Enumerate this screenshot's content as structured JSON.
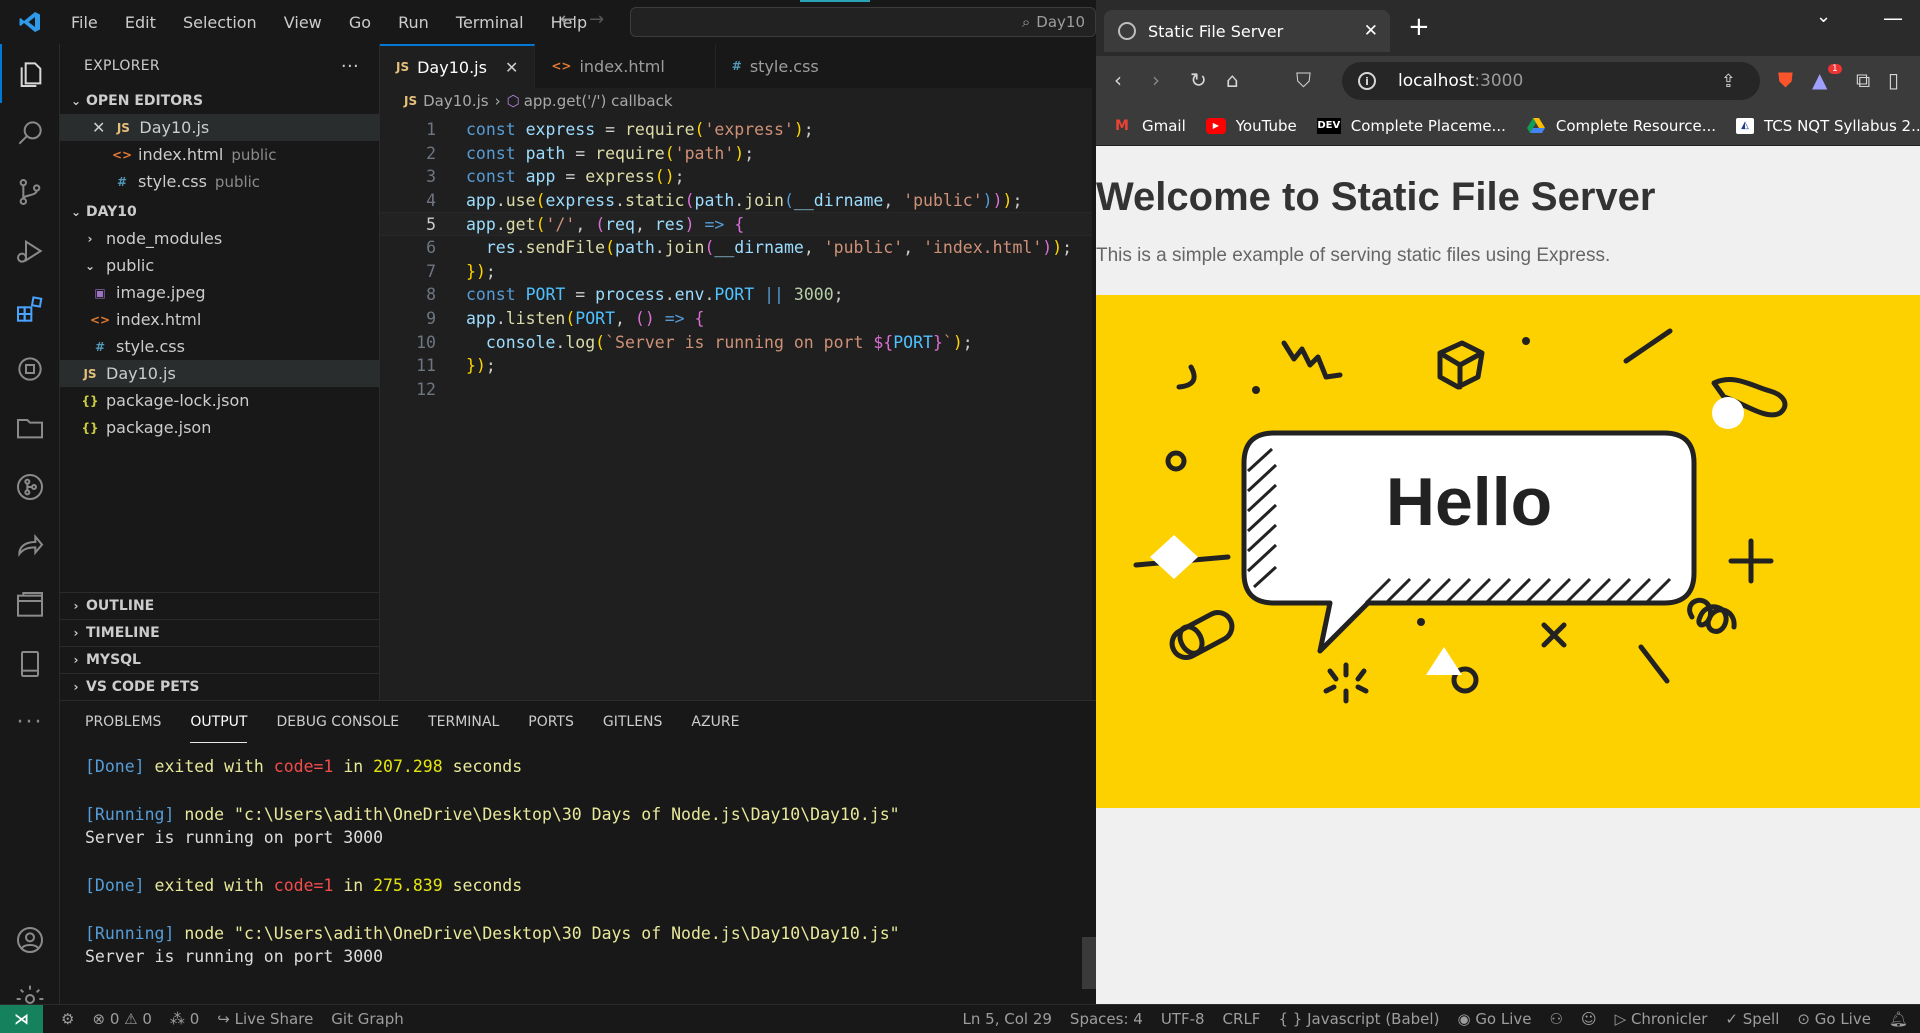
{
  "vscode": {
    "menu": [
      "File",
      "Edit",
      "Selection",
      "View",
      "Go",
      "Run",
      "Terminal",
      "Help"
    ],
    "command_center": "Day10",
    "explorer_title": "EXPLORER",
    "open_editors_title": "OPEN EDITORS",
    "open_editors": [
      {
        "name": "Day10.js",
        "kind": "JS",
        "folder": ""
      },
      {
        "name": "index.html",
        "kind": "<>",
        "folder": "public"
      },
      {
        "name": "style.css",
        "kind": "#",
        "folder": "public"
      }
    ],
    "folder_title": "DAY10",
    "tree": [
      {
        "name": "node_modules",
        "kind": "folder"
      },
      {
        "name": "public",
        "kind": "folder-open"
      },
      {
        "name": "image.jpeg",
        "kind": "img"
      },
      {
        "name": "index.html",
        "kind": "<>"
      },
      {
        "name": "style.css",
        "kind": "#"
      },
      {
        "name": "Day10.js",
        "kind": "JS"
      },
      {
        "name": "package-lock.json",
        "kind": "{}"
      },
      {
        "name": "package.json",
        "kind": "{}"
      }
    ],
    "sections": [
      "OUTLINE",
      "TIMELINE",
      "MYSQL",
      "VS CODE PETS"
    ],
    "tabs": [
      {
        "label": "Day10.js",
        "icon": "JS"
      },
      {
        "label": "index.html",
        "icon": "<>"
      },
      {
        "label": "style.css",
        "icon": "#"
      }
    ],
    "breadcrumb": {
      "file": "Day10.js",
      "symbol": "app.get('/') callback"
    },
    "code_lines": [
      "const express = require('express');",
      "const path = require('path');",
      "const app = express();",
      "app.use(express.static(path.join(__dirname, 'public')));",
      "app.get('/', (req, res) => {",
      "  res.sendFile(path.join(__dirname, 'public', 'index.html'));",
      "});",
      "const PORT = process.env.PORT || 3000;",
      "app.listen(PORT, () => {",
      "  console.log(`Server is running on port ${PORT}`);",
      "});",
      ""
    ],
    "panel_tabs": [
      "PROBLEMS",
      "OUTPUT",
      "DEBUG CONSOLE",
      "TERMINAL",
      "PORTS",
      "GITLENS",
      "AZURE"
    ],
    "output": {
      "done1": {
        "tag": "[Done]",
        "text1": "exited with",
        "code": "code=1",
        "text2": "in",
        "time": "207.298",
        "unit": "seconds"
      },
      "run1": {
        "tag": "[Running]",
        "cmd": "node \"c:\\Users\\adith\\OneDrive\\Desktop\\30 Days of Node.js\\Day10\\Day10.js\""
      },
      "msg1": "Server is running on port 3000",
      "done2": {
        "tag": "[Done]",
        "text1": "exited with",
        "code": "code=1",
        "text2": "in",
        "time": "275.839",
        "unit": "seconds"
      },
      "run2": {
        "tag": "[Running]",
        "cmd": "node \"c:\\Users\\adith\\OneDrive\\Desktop\\30 Days of Node.js\\Day10\\Day10.js\""
      },
      "msg2": "Server is running on port 3000"
    },
    "status": {
      "errors": "0",
      "warnings": "0",
      "ports": "0",
      "live_share": "Live Share",
      "git_graph": "Git Graph",
      "cursor": "Ln 5, Col 29",
      "spaces": "Spaces: 4",
      "encoding": "UTF-8",
      "eol": "CRLF",
      "language": "Javascript (Babel)",
      "go_live": "Go Live",
      "chronicler": "Chronicler",
      "spell": "Spell",
      "go_live2": "Go Live"
    }
  },
  "browser": {
    "tab_title": "Static File Server",
    "url_host": "localhost",
    "url_port": ":3000",
    "bookmarks": [
      "Gmail",
      "YouTube",
      "Complete Placeme...",
      "Complete Resource...",
      "TCS NQT Syllabus 2..."
    ],
    "badge_count": "1",
    "page_heading": "Welcome to Static File Server",
    "page_text": "This is a simple example of serving static files using Express.",
    "image_text": "Hello"
  },
  "colors": {
    "accent": "#0078d4",
    "remote": "#16825d",
    "image_bg": "#fdd000"
  }
}
